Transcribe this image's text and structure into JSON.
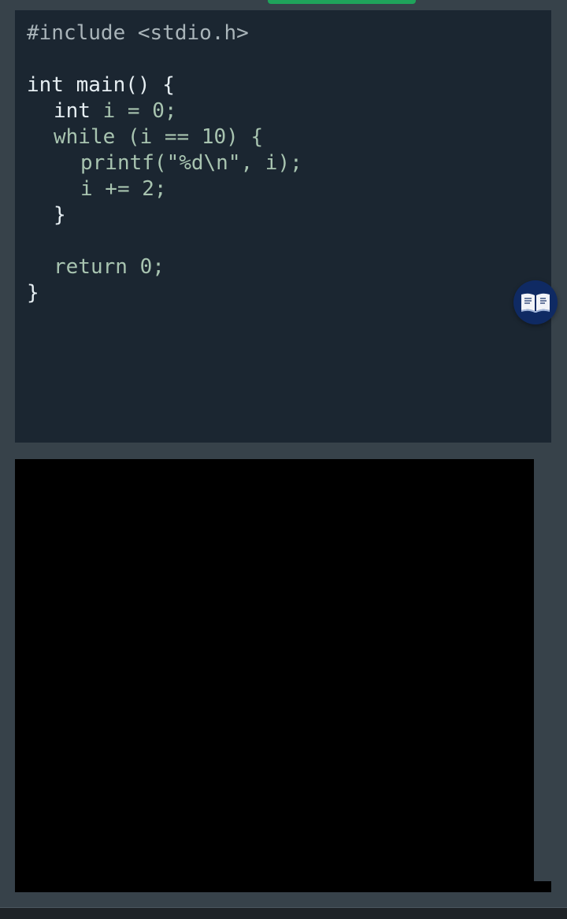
{
  "code": {
    "line_1_directive": "#include <stdio.h>",
    "line_3_keyword": "int",
    "line_3_rest": " main() {",
    "line_4_keyword": "int",
    "line_4_rest": " i = 0;",
    "line_5": "while (i == 10) {",
    "line_6": "printf(\"%d\\n\", i);",
    "line_7": "i += 2;",
    "line_8": "}",
    "line_10": "return 0;",
    "line_11": "}"
  },
  "icons": {
    "book_button": "book-icon"
  },
  "colors": {
    "background": "#37424a",
    "code_panel": "#1b2631",
    "code_text_green": "#a8c4b0",
    "code_text_white": "#e6eef2",
    "top_tab_accent": "#1fa35b",
    "book_button": "#0f2a63",
    "output_panel": "#000000"
  }
}
